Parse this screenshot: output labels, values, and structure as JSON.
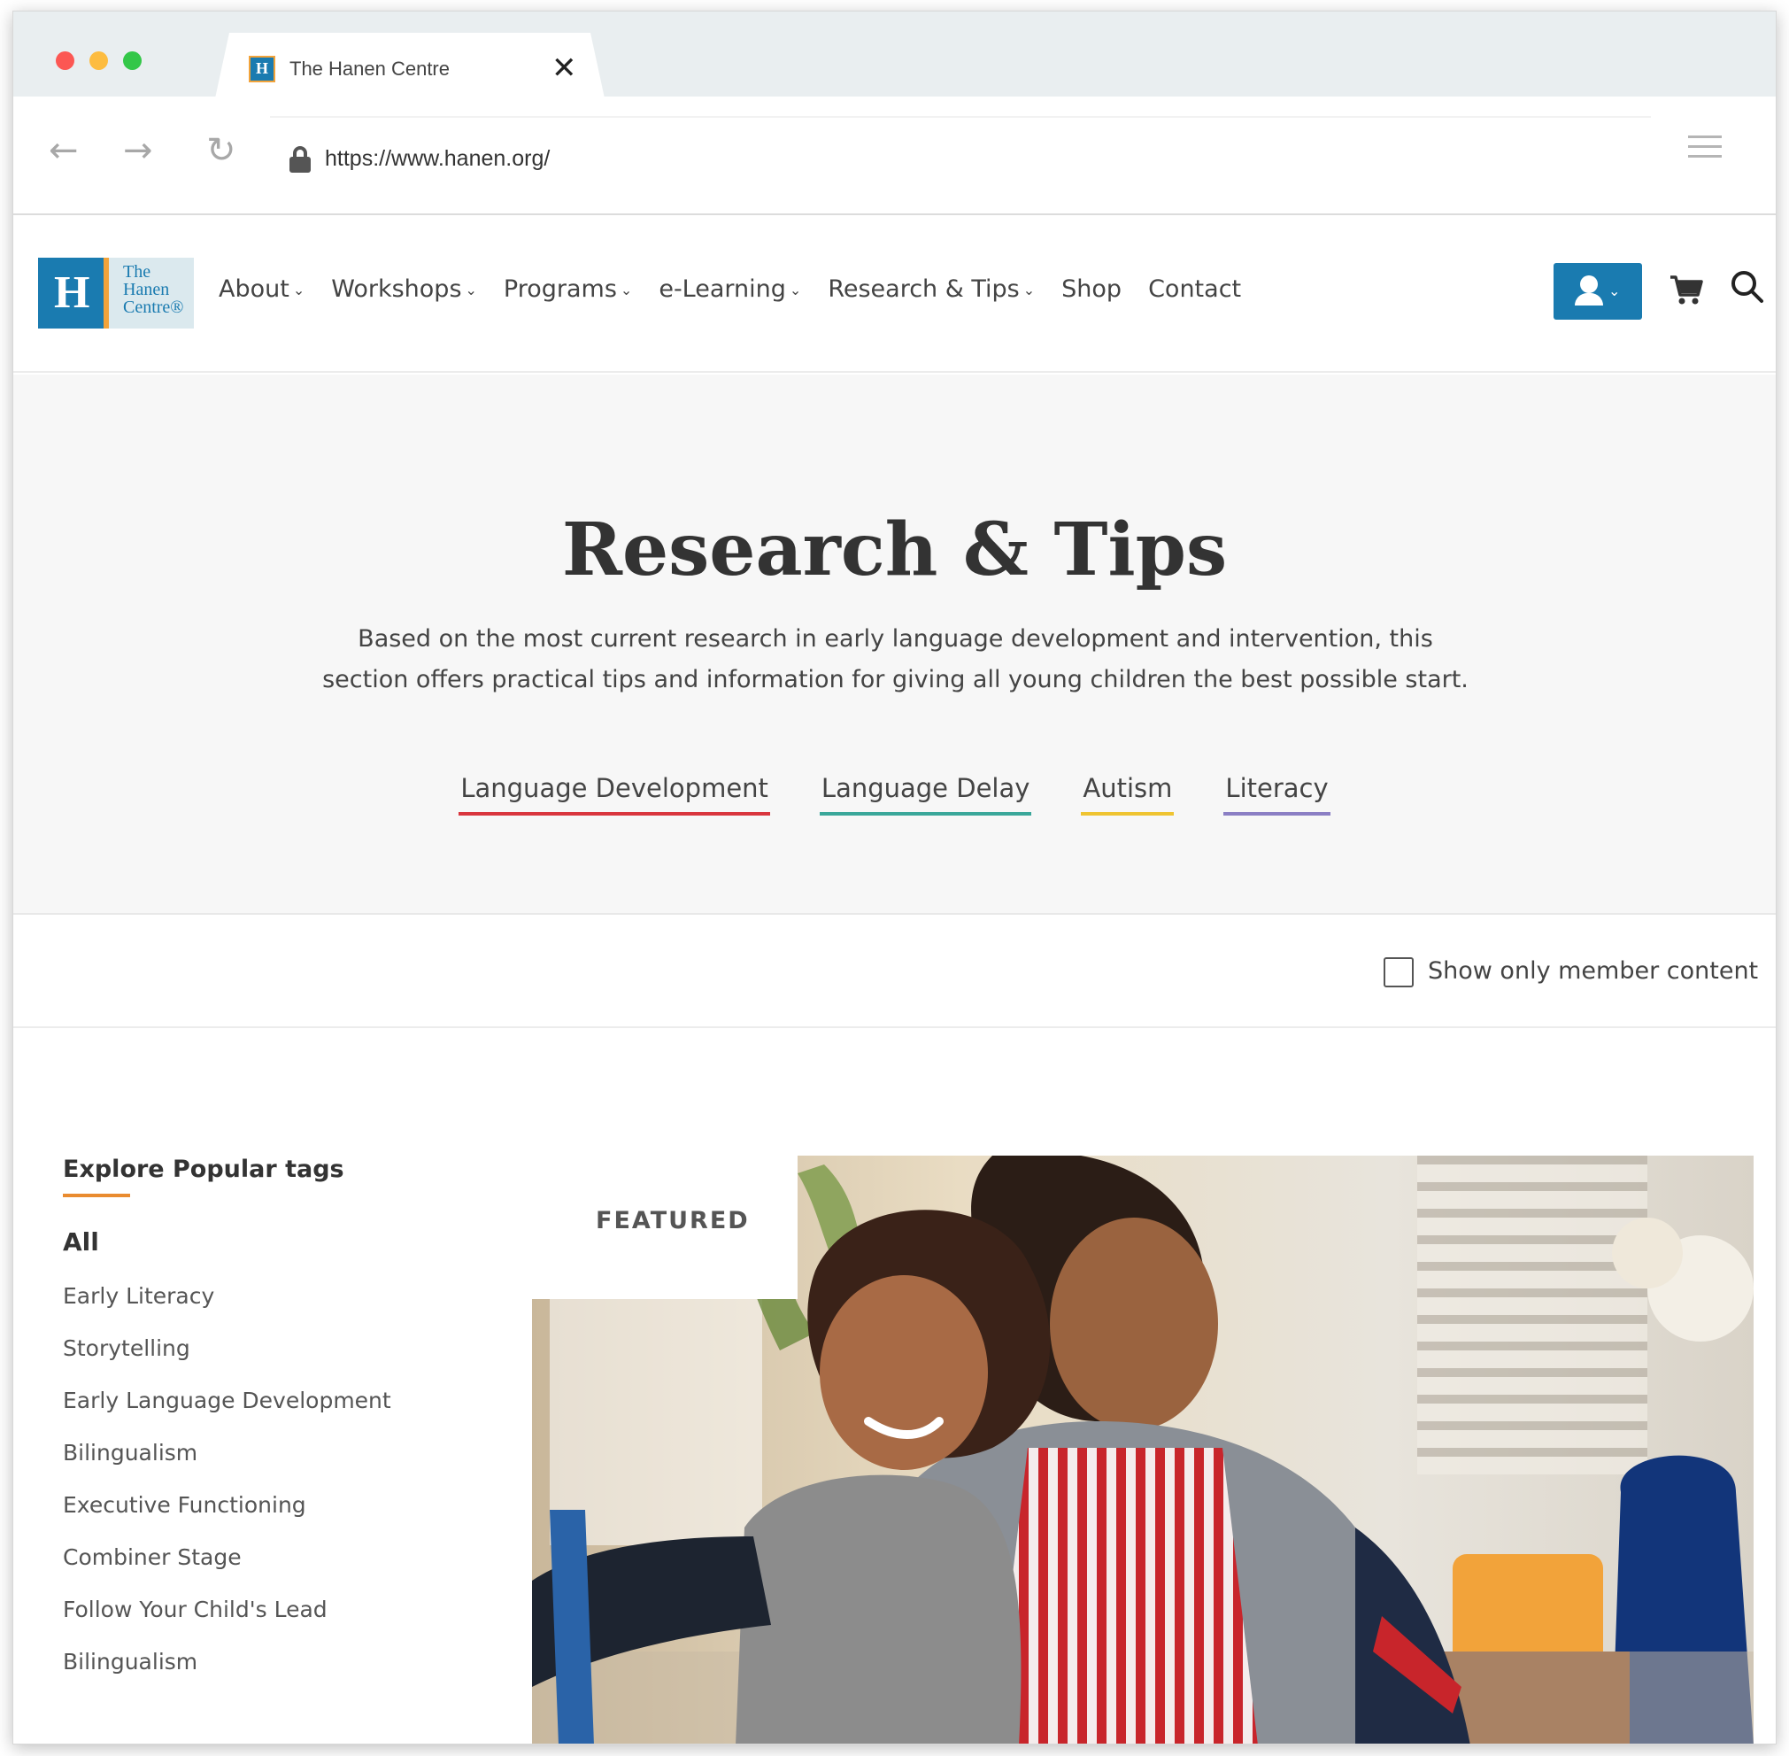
{
  "browser": {
    "tab_title": "The Hanen Centre",
    "close_glyph": "✕",
    "url": "https://www.hanen.org/",
    "icons": [
      "arrow-left-icon",
      "arrow-right-icon",
      "reload-icon",
      "lock-icon",
      "menu-icon"
    ]
  },
  "header": {
    "logo": {
      "line1": "The",
      "line2": "Hanen",
      "line3": "Centre®"
    },
    "nav": [
      {
        "label": "About",
        "has_dropdown": true
      },
      {
        "label": "Workshops",
        "has_dropdown": true
      },
      {
        "label": "Programs",
        "has_dropdown": true
      },
      {
        "label": "e-Learning",
        "has_dropdown": true
      },
      {
        "label": "Research & Tips",
        "has_dropdown": true
      },
      {
        "label": "Shop",
        "has_dropdown": false
      },
      {
        "label": "Contact",
        "has_dropdown": false
      }
    ],
    "chevron": "⌄",
    "accent_color": "#1a7bb0"
  },
  "hero": {
    "title": "Research & Tips",
    "description": "Based on the most current research in early language development and intervention, this section offers practical tips and information for giving all young children the best possible start.",
    "categories": [
      {
        "label": "Language Development",
        "color": "#d9363e"
      },
      {
        "label": "Language Delay",
        "color": "#3aa79a"
      },
      {
        "label": "Autism",
        "color": "#efc431"
      },
      {
        "label": "Literacy",
        "color": "#8b7fc4"
      }
    ]
  },
  "filter": {
    "checkbox_label": "Show only member content",
    "checked": false
  },
  "tags": {
    "heading": "Explore Popular tags",
    "all_label": "All",
    "items": [
      "Early Literacy",
      "Storytelling",
      "Early Language Development",
      "Bilingualism",
      "Executive Functioning",
      "Combiner Stage",
      "Follow Your Child's Lead",
      "Bilingualism"
    ]
  },
  "featured": {
    "label": "FEATURED",
    "image": "photo of a smiling girl and a man in a striped apron cooking together"
  }
}
